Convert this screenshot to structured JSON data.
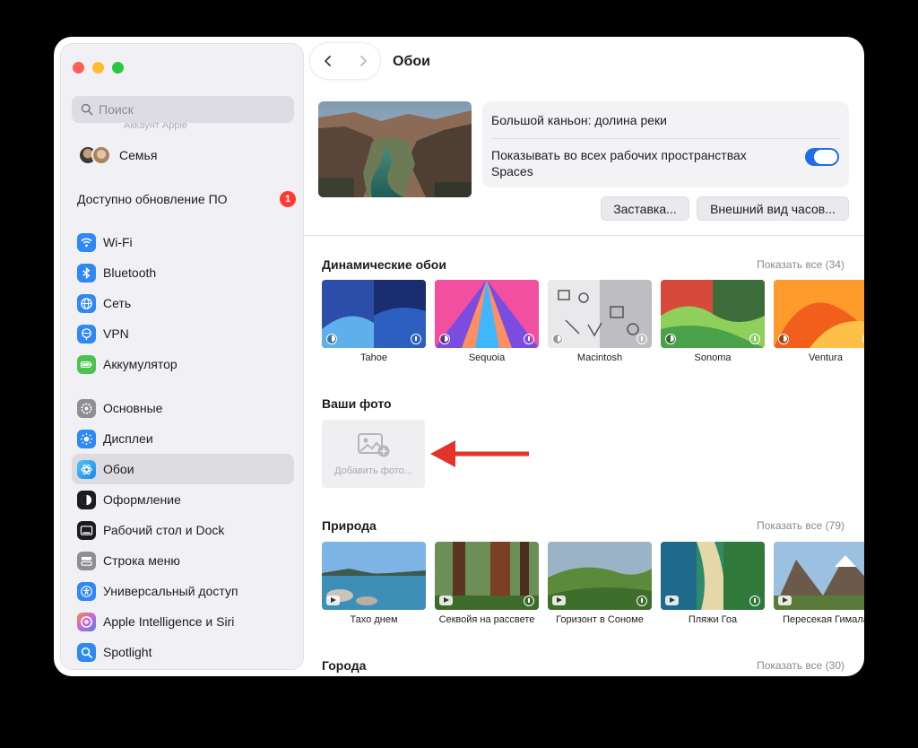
{
  "sidebar": {
    "search_placeholder": "Поиск",
    "account_ghost": "Аккаунт Apple",
    "family_label": "Семья",
    "update_label": "Доступно обновление ПО",
    "update_badge": "1",
    "group1": [
      {
        "label": "Wi-Fi",
        "icon": "wifi-icon",
        "color": "#2e88f5"
      },
      {
        "label": "Bluetooth",
        "icon": "bluetooth-icon",
        "color": "#2e88f5"
      },
      {
        "label": "Сеть",
        "icon": "network-icon",
        "color": "#2e88f5"
      },
      {
        "label": "VPN",
        "icon": "vpn-icon",
        "color": "#2e88f5"
      },
      {
        "label": "Аккумулятор",
        "icon": "battery-icon",
        "color": "#4cc34e"
      }
    ],
    "group2": [
      {
        "label": "Основные",
        "icon": "gear-icon",
        "color": "#8e8e93"
      },
      {
        "label": "Дисплеи",
        "icon": "display-icon",
        "color": "#2e88f5"
      },
      {
        "label": "Обои",
        "icon": "wallpaper-icon",
        "color": "#32a8f1",
        "active": true
      },
      {
        "label": "Оформление",
        "icon": "appearance-icon",
        "color": "#1c1c1e"
      },
      {
        "label": "Рабочий стол и Dock",
        "icon": "dock-icon",
        "color": "#1c1c1e"
      },
      {
        "label": "Строка меню",
        "icon": "menubar-icon",
        "color": "#8e8e93"
      },
      {
        "label": "Универсальный доступ",
        "icon": "accessibility-icon",
        "color": "#2e88f5"
      },
      {
        "label": "Apple Intelligence и Siri",
        "icon": "siri-icon",
        "color": "#c46ad8"
      },
      {
        "label": "Spotlight",
        "icon": "spotlight-icon",
        "color": "#2e88f5"
      }
    ]
  },
  "content": {
    "title": "Обои",
    "current_name": "Большой каньон: долина реки",
    "spaces_label": "Показывать во всех рабочих пространствах Spaces",
    "spaces_on": true,
    "btn_screensaver": "Заставка...",
    "btn_clock": "Внешний вид часов...",
    "dynamic": {
      "title": "Динамические обои",
      "show_all": "Показать все (34)",
      "items": [
        "Tahoe",
        "Sequoia",
        "Macintosh",
        "Sonoma",
        "Ventura"
      ]
    },
    "photos": {
      "title": "Ваши фото",
      "add_label": "Добавить фото..."
    },
    "nature": {
      "title": "Природа",
      "show_all": "Показать все (79)",
      "items": [
        "Тахо днем",
        "Секвойя на рассвете",
        "Горизонт в Сономе",
        "Пляжи Гоа",
        "Пересекая Гимала"
      ]
    },
    "cities": {
      "title": "Города",
      "show_all": "Показать все (30)"
    }
  },
  "accent_color": "#1f6dea",
  "arrow_color": "#e3332a"
}
